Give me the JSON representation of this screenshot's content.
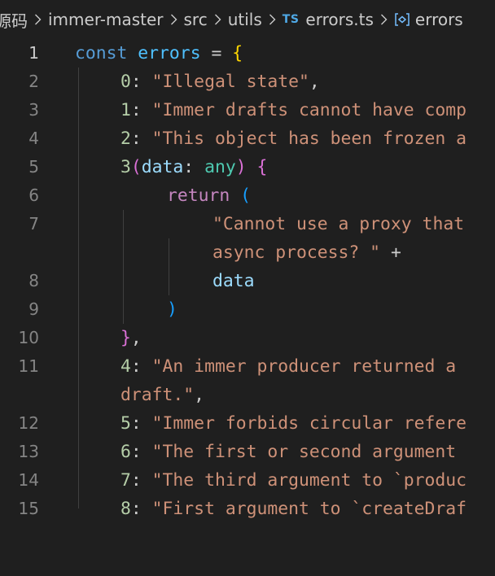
{
  "breadcrumb": {
    "items": [
      "源码",
      "immer-master",
      "src",
      "utils",
      "errors.ts",
      "errors"
    ],
    "file_icon_text": "TS",
    "symbol_icon": "variable-symbol-icon",
    "separator_icon": "chevron-right-icon"
  },
  "editor": {
    "language": "typescript",
    "active_line": 1,
    "lines": [
      {
        "ln": "1",
        "tokens": [
          "const",
          "errors",
          "=",
          "{"
        ]
      },
      {
        "ln": "2",
        "tokens": [
          "0",
          ":",
          "\"Illegal state\"",
          ","
        ]
      },
      {
        "ln": "3",
        "tokens": [
          "1",
          ":",
          "\"Immer drafts cannot have comp"
        ]
      },
      {
        "ln": "4",
        "tokens": [
          "2",
          ":",
          "\"This object has been frozen a"
        ]
      },
      {
        "ln": "5",
        "tokens": [
          "3",
          "(",
          "data",
          ":",
          "any",
          ")",
          "{"
        ]
      },
      {
        "ln": "6",
        "tokens": [
          "return",
          "("
        ]
      },
      {
        "ln": "7",
        "tokens": [
          "\"Cannot use a proxy that"
        ]
      },
      {
        "ln": "",
        "tokens": [
          "async process? \"",
          "+"
        ]
      },
      {
        "ln": "8",
        "tokens": [
          "data"
        ]
      },
      {
        "ln": "9",
        "tokens": [
          ")"
        ]
      },
      {
        "ln": "10",
        "tokens": [
          "}",
          ","
        ]
      },
      {
        "ln": "11",
        "tokens": [
          "4",
          ":",
          "\"An immer producer returned a"
        ]
      },
      {
        "ln": "",
        "tokens": [
          "draft.\"",
          ","
        ]
      },
      {
        "ln": "12",
        "tokens": [
          "5",
          ":",
          "\"Immer forbids circular refere"
        ]
      },
      {
        "ln": "13",
        "tokens": [
          "6",
          ":",
          "\"The first or second argument"
        ]
      },
      {
        "ln": "14",
        "tokens": [
          "7",
          ":",
          "\"The third argument to `produc"
        ]
      },
      {
        "ln": "15",
        "tokens": [
          "8",
          ":",
          "\"First argument to `createDraf"
        ]
      }
    ]
  },
  "colors": {
    "background": "#1f1f1f",
    "keyword": "#569cd6",
    "variable": "#4fc1ff",
    "string": "#ce9178",
    "number": "#b5cea8",
    "control": "#c586c0",
    "parameter": "#9cdcfe",
    "type": "#4ec9b0",
    "bracket_level1": "#ffd700",
    "bracket_level2": "#da70d6",
    "bracket_level3": "#179fff",
    "line_number": "#858585",
    "ts_icon": "#4fa9e6"
  }
}
